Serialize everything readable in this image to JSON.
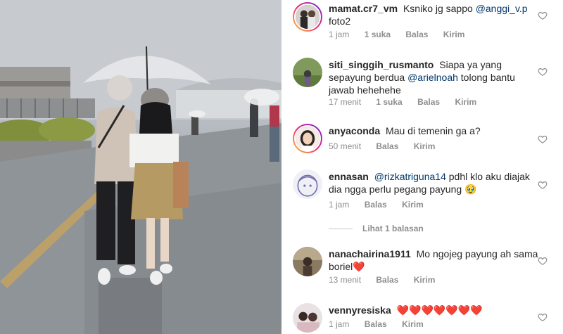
{
  "photo": {
    "alt_subject": "couple-under-umbrella"
  },
  "comments": [
    {
      "username": "mamat.cr7_vm",
      "text_before": "Ksniko jg sappo",
      "mention": "@anggi_v.p",
      "text_after": "foto2",
      "time": "1 jam",
      "likes": "1 suka",
      "reply": "Balas",
      "send": "Kirim"
    },
    {
      "username": "siti_singgih_rusmanto",
      "text_before": "Siapa ya yang sepayung berdua",
      "mention": "@arielnoah",
      "text_after": "tolong bantu jawab hehehehe",
      "time": "17 menit",
      "likes": "1 suka",
      "reply": "Balas",
      "send": "Kirim"
    },
    {
      "username": "anyaconda",
      "text_before": "Mau di temenin ga a?",
      "time": "50 menit",
      "reply": "Balas",
      "send": "Kirim"
    },
    {
      "username": "ennasan",
      "mention": "@rizkatriguna14",
      "text_after": "pdhl klo aku diajak dia ngga perlu pegang payung 🥹",
      "time": "1 jam",
      "reply": "Balas",
      "send": "Kirim",
      "view_replies": "Lihat 1 balasan"
    },
    {
      "username": "nanachairina1911",
      "text_before": "Mo ngojeg payung ah sama boriel❤️",
      "time": "13 menit",
      "reply": "Balas",
      "send": "Kirim"
    },
    {
      "username": "vennyresiska",
      "text_before": "❤️❤️❤️❤️❤️❤️❤️",
      "time": "1 jam",
      "reply": "Balas",
      "send": "Kirim"
    }
  ],
  "colors": {
    "mention": "#00376b",
    "meta": "#8e8e8e",
    "heart_emoji": "#e3172e"
  }
}
